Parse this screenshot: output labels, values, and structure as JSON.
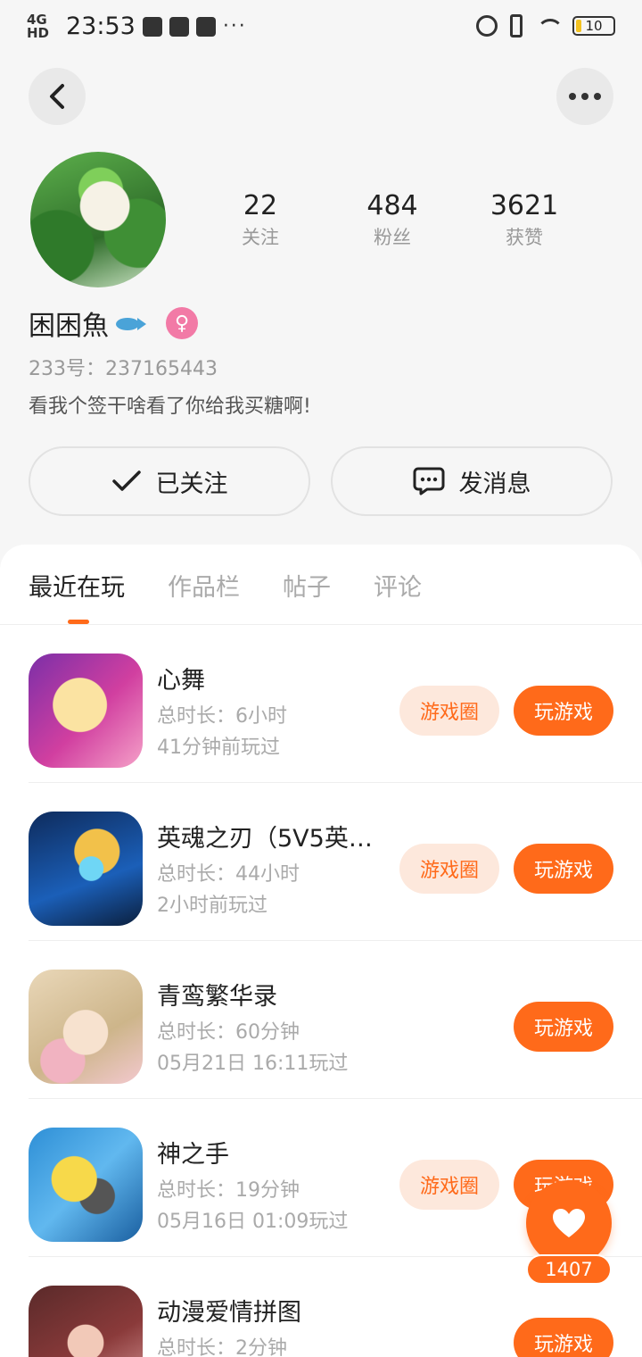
{
  "status_bar": {
    "network": "4G HD",
    "time": "23:53",
    "battery": "10",
    "more": "···"
  },
  "profile": {
    "stats": [
      {
        "num": "22",
        "label": "关注"
      },
      {
        "num": "484",
        "label": "粉丝"
      },
      {
        "num": "3621",
        "label": "获赞"
      }
    ],
    "name": "困困魚",
    "gender_symbol": "♀",
    "uid": "233号：237165443",
    "bio": "看我个签干啥看了你给我买糖啊!",
    "follow_label": "已关注",
    "message_label": "发消息"
  },
  "tabs": [
    {
      "label": "最近在玩",
      "active": true
    },
    {
      "label": "作品栏",
      "active": false
    },
    {
      "label": "帖子",
      "active": false
    },
    {
      "label": "评论",
      "active": false
    }
  ],
  "games": [
    {
      "title": "心舞",
      "duration": "总时长：6小时",
      "last_played": "41分钟前玩过",
      "circle_label": "游戏圈",
      "play_label": "玩游戏",
      "has_circle": true,
      "icon_color": "#d13fa0"
    },
    {
      "title": "英魂之刃（5V5英雄…",
      "duration": "总时长：44小时",
      "last_played": "2小时前玩过",
      "circle_label": "游戏圈",
      "play_label": "玩游戏",
      "has_circle": true,
      "icon_color": "#1b5fb8"
    },
    {
      "title": "青鸾繁华录",
      "duration": "总时长：60分钟",
      "last_played": "05月21日 16:11玩过",
      "circle_label": "",
      "play_label": "玩游戏",
      "has_circle": false,
      "icon_color": "#e9d7b8"
    },
    {
      "title": "神之手",
      "duration": "总时长：19分钟",
      "last_played": "05月16日 01:09玩过",
      "circle_label": "游戏圈",
      "play_label": "玩游戏",
      "has_circle": true,
      "icon_color": "#2e8fd6"
    },
    {
      "title": "动漫爱情拼图",
      "duration": "总时长：2分钟",
      "last_played": "",
      "circle_label": "",
      "play_label": "玩游戏",
      "has_circle": false,
      "icon_color": "#8a3a3a"
    }
  ],
  "floating_like": {
    "count": "1407"
  },
  "colors": {
    "accent": "#ff6a1a",
    "accent_light": "#fde8dc"
  }
}
